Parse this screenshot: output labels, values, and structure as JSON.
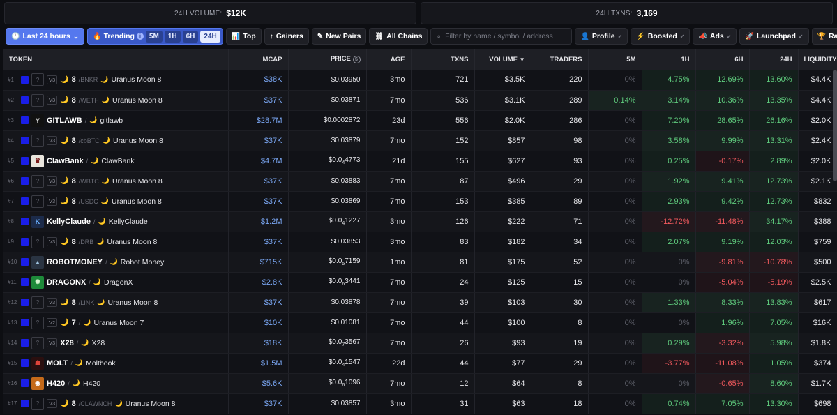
{
  "stats": {
    "volume_label": "24H VOLUME:",
    "volume_value": "$12K",
    "txns_label": "24H TXNS:",
    "txns_value": "3,169"
  },
  "toolbar": {
    "timeframe_label": "Last 24 hours",
    "trending_label": "Trending",
    "tf_5m": "5M",
    "tf_1h": "1H",
    "tf_6h": "6H",
    "tf_24h": "24H",
    "top_label": "Top",
    "gainers_label": "Gainers",
    "new_pairs_label": "New Pairs",
    "all_chains_label": "All Chains",
    "search_placeholder": "Filter by name / symbol / address",
    "profile_label": "Profile",
    "boosted_label": "Boosted",
    "ads_label": "Ads",
    "launchpad_label": "Launchpad",
    "rank_label": "Rank by:"
  },
  "columns": {
    "token": "TOKEN",
    "mcap": "MCAP",
    "price": "PRICE",
    "age": "AGE",
    "txns": "TXNS",
    "volume": "VOLUME",
    "traders": "TRADERS",
    "m5": "5M",
    "h1": "1H",
    "h6": "6H",
    "h24": "24H",
    "liquidity": "LIQUIDITY"
  },
  "colors": {
    "accent": "#5578ee",
    "positive": "#5fcb7d",
    "negative": "#f0595d",
    "chain": "#1a1ee8"
  },
  "rows": [
    {
      "rank": "#1",
      "ver": "V3",
      "logo": "placeholder",
      "sym": "8",
      "quote": "/BNKR",
      "name": "Uranus Moon 8",
      "moon": true,
      "mcap": "$38K",
      "price": "$0.03950",
      "age": "3mo",
      "txns": "721",
      "volume": "$3.5K",
      "traders": "220",
      "m5": "0%",
      "h1": "4.75%",
      "h6": "12.69%",
      "h24": "13.60%",
      "liq": "$4.4K"
    },
    {
      "rank": "#2",
      "ver": "V3",
      "logo": "placeholder",
      "sym": "8",
      "quote": "/WETH",
      "name": "Uranus Moon 8",
      "moon": true,
      "mcap": "$37K",
      "price": "$0.03871",
      "age": "7mo",
      "txns": "536",
      "volume": "$3.1K",
      "traders": "289",
      "m5": "0.14%",
      "h1": "3.14%",
      "h6": "10.36%",
      "h24": "13.35%",
      "liq": "$4.4K"
    },
    {
      "rank": "#3",
      "ver": "",
      "logo": "gitlawb",
      "sym": "GITLAWB",
      "quote": "/",
      "name": "gitlawb",
      "moon": false,
      "mcap": "$28.7M",
      "price": "$0.0002872",
      "age": "23d",
      "txns": "556",
      "volume": "$2.0K",
      "traders": "286",
      "m5": "0%",
      "h1": "7.20%",
      "h6": "28.65%",
      "h24": "26.16%",
      "liq": "$2.0K"
    },
    {
      "rank": "#4",
      "ver": "V3",
      "logo": "placeholder",
      "sym": "8",
      "quote": "/cbBTC",
      "name": "Uranus Moon 8",
      "moon": true,
      "mcap": "$37K",
      "price": "$0.03879",
      "age": "7mo",
      "txns": "152",
      "volume": "$857",
      "traders": "98",
      "m5": "0%",
      "h1": "3.58%",
      "h6": "9.99%",
      "h24": "13.31%",
      "liq": "$2.4K"
    },
    {
      "rank": "#5",
      "ver": "",
      "logo": "clawbank",
      "sym": "ClawBank",
      "quote": "/",
      "name": "ClawBank",
      "moon": false,
      "mcap": "$4.7M",
      "price_pre": "$0.0",
      "price_sub": "4",
      "price_post": "4773",
      "age": "21d",
      "txns": "155",
      "volume": "$627",
      "traders": "93",
      "m5": "0%",
      "h1": "0.25%",
      "h6": "-0.17%",
      "h24": "2.89%",
      "liq": "$2.0K"
    },
    {
      "rank": "#6",
      "ver": "V3",
      "logo": "placeholder",
      "sym": "8",
      "quote": "/WBTC",
      "name": "Uranus Moon 8",
      "moon": true,
      "mcap": "$37K",
      "price": "$0.03883",
      "age": "7mo",
      "txns": "87",
      "volume": "$496",
      "traders": "29",
      "m5": "0%",
      "h1": "1.92%",
      "h6": "9.41%",
      "h24": "12.73%",
      "liq": "$2.1K"
    },
    {
      "rank": "#7",
      "ver": "V3",
      "logo": "placeholder",
      "sym": "8",
      "quote": "/USDC",
      "name": "Uranus Moon 8",
      "moon": true,
      "mcap": "$37K",
      "price": "$0.03869",
      "age": "7mo",
      "txns": "153",
      "volume": "$385",
      "traders": "89",
      "m5": "0%",
      "h1": "2.93%",
      "h6": "9.42%",
      "h24": "12.73%",
      "liq": "$832"
    },
    {
      "rank": "#8",
      "ver": "",
      "logo": "kellyclaude",
      "sym": "KellyClaude",
      "quote": "/",
      "name": "KellyClaude",
      "moon": false,
      "mcap": "$1.2M",
      "price_pre": "$0.0",
      "price_sub": "4",
      "price_post": "1227",
      "age": "3mo",
      "txns": "126",
      "volume": "$222",
      "traders": "71",
      "m5": "0%",
      "h1": "-12.72%",
      "h6": "-11.48%",
      "h24": "34.17%",
      "liq": "$388"
    },
    {
      "rank": "#9",
      "ver": "V3",
      "logo": "placeholder",
      "sym": "8",
      "quote": "/DRB",
      "name": "Uranus Moon 8",
      "moon": true,
      "mcap": "$37K",
      "price": "$0.03853",
      "age": "3mo",
      "txns": "83",
      "volume": "$182",
      "traders": "34",
      "m5": "0%",
      "h1": "2.07%",
      "h6": "9.19%",
      "h24": "12.03%",
      "liq": "$759"
    },
    {
      "rank": "#10",
      "ver": "",
      "logo": "robotmoney",
      "sym": "ROBOTMONEY",
      "quote": "/",
      "name": "Robot Money",
      "moon": false,
      "mcap": "$715K",
      "price_pre": "$0.0",
      "price_sub": "5",
      "price_post": "7159",
      "age": "1mo",
      "txns": "81",
      "volume": "$175",
      "traders": "52",
      "m5": "0%",
      "h1": "0%",
      "h6": "-9.81%",
      "h24": "-10.78%",
      "liq": "$500"
    },
    {
      "rank": "#11",
      "ver": "",
      "logo": "dragonx",
      "sym": "DRAGONX",
      "quote": "/",
      "name": "DragonX",
      "moon": false,
      "mcap": "$2.8K",
      "price_pre": "$0.0",
      "price_sub": "6",
      "price_post": "3441",
      "age": "7mo",
      "txns": "24",
      "volume": "$125",
      "traders": "15",
      "m5": "0%",
      "h1": "0%",
      "h6": "-5.04%",
      "h24": "-5.19%",
      "liq": "$2.5K"
    },
    {
      "rank": "#12",
      "ver": "V3",
      "logo": "placeholder",
      "sym": "8",
      "quote": "/LINK",
      "name": "Uranus Moon 8",
      "moon": true,
      "mcap": "$37K",
      "price": "$0.03878",
      "age": "7mo",
      "txns": "39",
      "volume": "$103",
      "traders": "30",
      "m5": "0%",
      "h1": "1.33%",
      "h6": "8.33%",
      "h24": "13.83%",
      "liq": "$617"
    },
    {
      "rank": "#13",
      "ver": "V2",
      "logo": "placeholder",
      "sym": "7",
      "quote": "/",
      "name": "Uranus Moon 7",
      "moon": true,
      "mcap": "$10K",
      "price": "$0.01081",
      "age": "7mo",
      "txns": "44",
      "volume": "$100",
      "traders": "8",
      "m5": "0%",
      "h1": "0%",
      "h6": "1.96%",
      "h24": "7.05%",
      "liq": "$16K"
    },
    {
      "rank": "#14",
      "ver": "V3",
      "logo": "placeholder",
      "sym": "X28",
      "quote": "/",
      "name": "X28",
      "moon": false,
      "mcap": "$18K",
      "price_pre": "$0.0",
      "price_sub": "7",
      "price_post": "3567",
      "age": "7mo",
      "txns": "26",
      "volume": "$93",
      "traders": "19",
      "m5": "0%",
      "h1": "0.29%",
      "h6": "-3.32%",
      "h24": "5.98%",
      "liq": "$1.8K"
    },
    {
      "rank": "#15",
      "ver": "",
      "logo": "molt",
      "sym": "MOLT",
      "quote": "/",
      "name": "Moltbook",
      "moon": false,
      "mcap": "$1.5M",
      "price_pre": "$0.0",
      "price_sub": "4",
      "price_post": "1547",
      "age": "22d",
      "txns": "44",
      "volume": "$77",
      "traders": "29",
      "m5": "0%",
      "h1": "-3.77%",
      "h6": "-11.08%",
      "h24": "1.05%",
      "liq": "$374"
    },
    {
      "rank": "#16",
      "ver": "",
      "logo": "h420",
      "sym": "H420",
      "quote": "/",
      "name": "H420",
      "moon": false,
      "mcap": "$5.6K",
      "price_pre": "$0.0",
      "price_sub": "6",
      "price_post": "1096",
      "age": "7mo",
      "txns": "12",
      "volume": "$64",
      "traders": "8",
      "m5": "0%",
      "h1": "0%",
      "h6": "-0.65%",
      "h24": "8.60%",
      "liq": "$1.7K"
    },
    {
      "rank": "#17",
      "ver": "V3",
      "logo": "placeholder",
      "sym": "8",
      "quote": "/CLAWNCH",
      "name": "Uranus Moon 8",
      "moon": true,
      "mcap": "$37K",
      "price": "$0.03857",
      "age": "3mo",
      "txns": "31",
      "volume": "$63",
      "traders": "18",
      "m5": "0%",
      "h1": "0.74%",
      "h6": "7.05%",
      "h24": "13.30%",
      "liq": "$698"
    }
  ]
}
